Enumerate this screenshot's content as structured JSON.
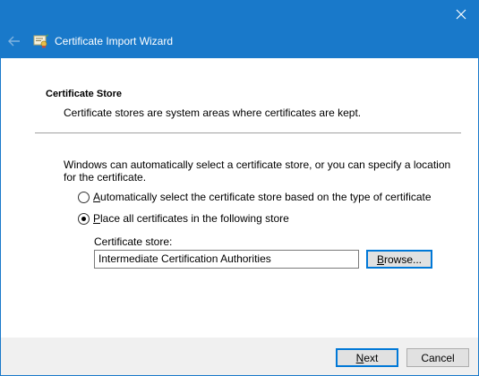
{
  "window": {
    "title": "Certificate Import Wizard",
    "accent_color": "#1979ca"
  },
  "icons": {
    "close": "close-icon",
    "back": "back-arrow-icon",
    "app": "certificate-icon"
  },
  "section": {
    "title": "Certificate Store",
    "description": "Certificate stores are system areas where certificates are kept."
  },
  "info": "Windows can automatically select a certificate store, or you can specify a location for the certificate.",
  "options": [
    {
      "label_first": "A",
      "label_rest": "utomatically select the certificate store based on the type of certificate",
      "checked": false
    },
    {
      "label_first": "P",
      "label_rest": "lace all certificates in the following store",
      "checked": true
    }
  ],
  "store": {
    "label": "Certificate store:",
    "value": "Intermediate Certification Authorities"
  },
  "buttons": {
    "browse_first": "B",
    "browse_rest": "rowse...",
    "next_first": "N",
    "next_rest": "ext",
    "cancel": "Cancel"
  }
}
